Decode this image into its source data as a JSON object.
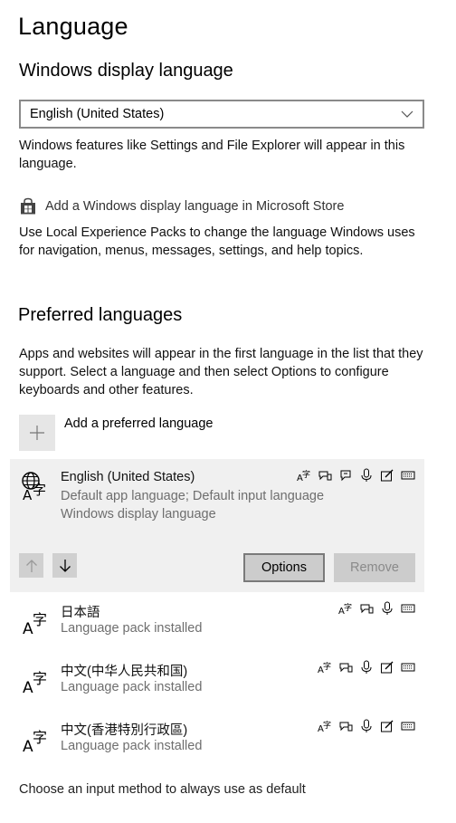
{
  "page": {
    "title": "Language"
  },
  "display_language": {
    "heading": "Windows display language",
    "selected": "English (United States)",
    "description": "Windows features like Settings and File Explorer will appear in this language.",
    "store_link": "Add a Windows display language in Microsoft Store",
    "store_icon": "store-bag-icon",
    "lxp_note": "Use Local Experience Packs to change the language Windows uses for navigation, menus, messages, settings, and help topics."
  },
  "preferred": {
    "heading": "Preferred languages",
    "description": "Apps and websites will appear in the first language in the list that they support. Select a language and then select Options to configure keyboards and other features.",
    "add_label": "Add a preferred language",
    "languages": [
      {
        "name": "English (United States)",
        "line1": "Default app language; Default input language",
        "line2": "Windows display language",
        "selected": true,
        "icon": "globe-language-icon",
        "features": [
          "display",
          "speech-recognition",
          "text-to-speech",
          "microphone",
          "handwriting",
          "keyboard"
        ]
      },
      {
        "name": "日本語",
        "line1": "Language pack installed",
        "selected": false,
        "icon": "language-icon",
        "features": [
          "display",
          "speech-recognition",
          "microphone",
          "keyboard"
        ]
      },
      {
        "name": "中文(中华人民共和国)",
        "line1": "Language pack installed",
        "selected": false,
        "icon": "language-icon",
        "features": [
          "display",
          "speech-recognition",
          "microphone",
          "handwriting",
          "keyboard"
        ]
      },
      {
        "name": "中文(香港特別行政區)",
        "line1": "Language pack installed",
        "selected": false,
        "icon": "language-icon",
        "features": [
          "display",
          "speech-recognition",
          "microphone",
          "handwriting",
          "keyboard"
        ]
      }
    ],
    "options_label": "Options",
    "remove_label": "Remove"
  },
  "footer": {
    "input_method_link": "Choose an input method to always use as default"
  }
}
